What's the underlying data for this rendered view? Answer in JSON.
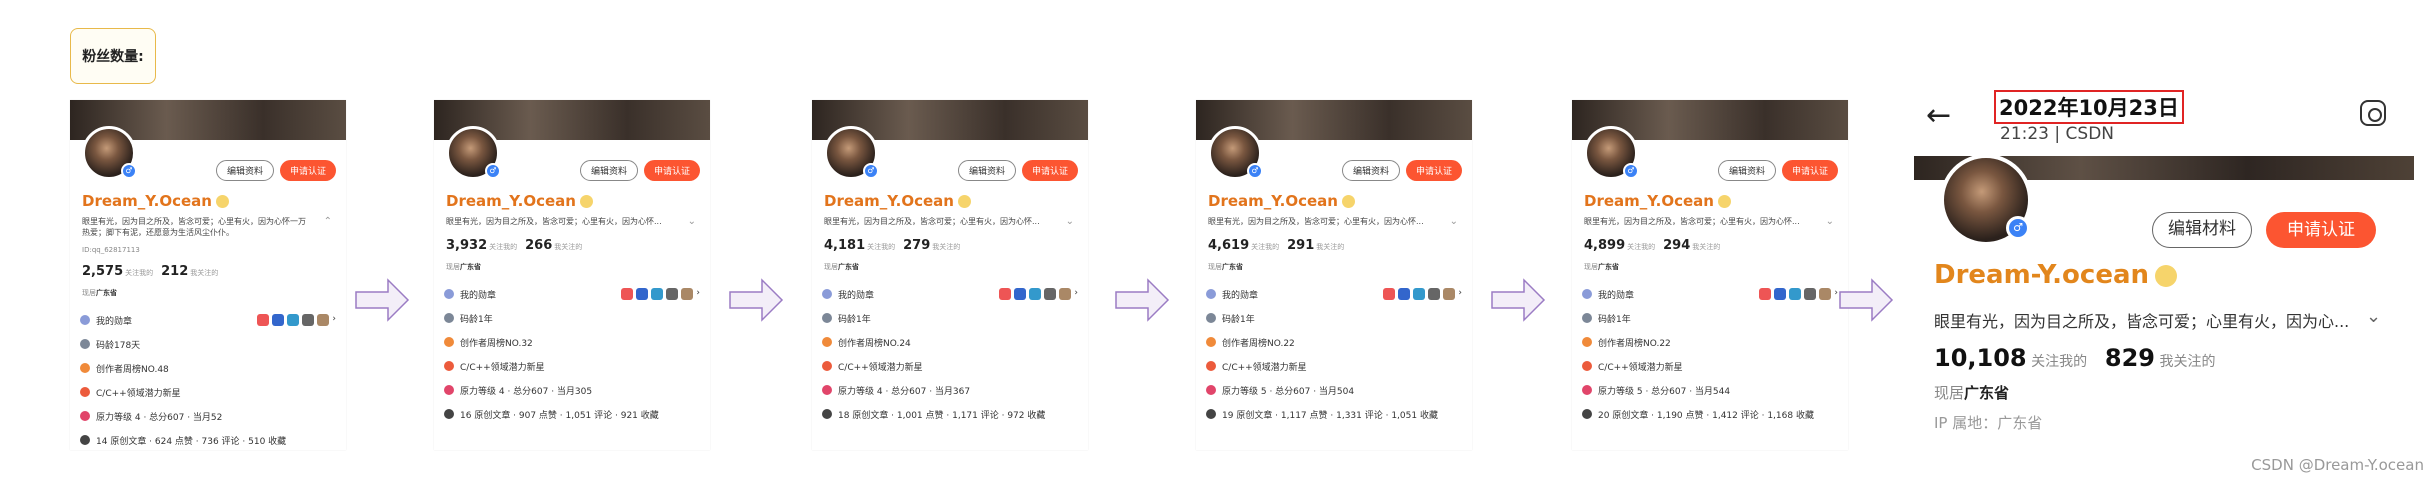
{
  "label": "粉丝数量:",
  "common": {
    "edit": "编辑资料",
    "apply": "申请认证",
    "name": "Dream_Y.Ocean",
    "bio": "眼里有光，因为目之所及，皆念可爱；心里有火，因为心怀一万热爱；脚下有泥，还愿意为生活风尘仆仆。",
    "bio_short": "眼里有光，因为目之所及，皆念可爱；心里有火，因为心怀...",
    "fans_label": "关注我的",
    "follow_label": "我关注的",
    "loc_prefix": "现居",
    "loc": "广东省",
    "medal": "我的勋章",
    "age": "码龄1年",
    "age2": "码龄178天",
    "ranking_label": "创作者周榜",
    "newstar": "C/C++领域潜力新星",
    "level_label": "原力等级",
    "total_label": "总分",
    "month_label": "当月",
    "orig_label": "原创文章",
    "likes_label": "点赞",
    "comment_label": "评论",
    "collect_label": "收藏",
    "qq": "ID:qq_62817113"
  },
  "cards": [
    {
      "fans": "2,575",
      "follow": "212",
      "age": "码龄178天",
      "ranking": "NO.48",
      "level": "4",
      "total": "607",
      "month": "52",
      "orig": "14",
      "likes": "624",
      "comments": "736",
      "collects": "510"
    },
    {
      "fans": "3,932",
      "follow": "266",
      "age": "码龄1年",
      "ranking": "NO.32",
      "level": "4",
      "total": "607",
      "month": "305",
      "orig": "16",
      "likes": "907",
      "comments": "1,051",
      "collects": "921"
    },
    {
      "fans": "4,181",
      "follow": "279",
      "age": "码龄1年",
      "ranking": "NO.24",
      "level": "4",
      "total": "607",
      "month": "367",
      "orig": "18",
      "likes": "1,001",
      "comments": "1,171",
      "collects": "972"
    },
    {
      "fans": "4,619",
      "follow": "291",
      "age": "码龄1年",
      "ranking": "NO.22",
      "level": "5",
      "total": "607",
      "month": "504",
      "orig": "19",
      "likes": "1,117",
      "comments": "1,331",
      "collects": "1,051"
    },
    {
      "fans": "4,899",
      "follow": "294",
      "age": "码龄1年",
      "ranking": "NO.22",
      "level": "5",
      "total": "607",
      "month": "544",
      "orig": "20",
      "likes": "1,190",
      "comments": "1,412",
      "collects": "1,168"
    }
  ],
  "big": {
    "date": "2022年10月23日",
    "time": "21:23 | CSDN",
    "edit": "编辑材料",
    "apply": "申请认证",
    "name": "Dream-Y.ocean",
    "bio": "眼里有光，因为目之所及，皆念可爱；心里有火，因为心...",
    "fans": "10,108",
    "fans_label": "关注我的",
    "follow": "829",
    "follow_label": "我关注的",
    "loc_prefix": "现居",
    "loc": "广东省",
    "ip": "IP 属地：广东省"
  },
  "watermark": "CSDN @Dream-Y.ocean",
  "colors": {
    "accent": "#fc5531",
    "name": "#e2741c",
    "highlight": "#e02424"
  }
}
